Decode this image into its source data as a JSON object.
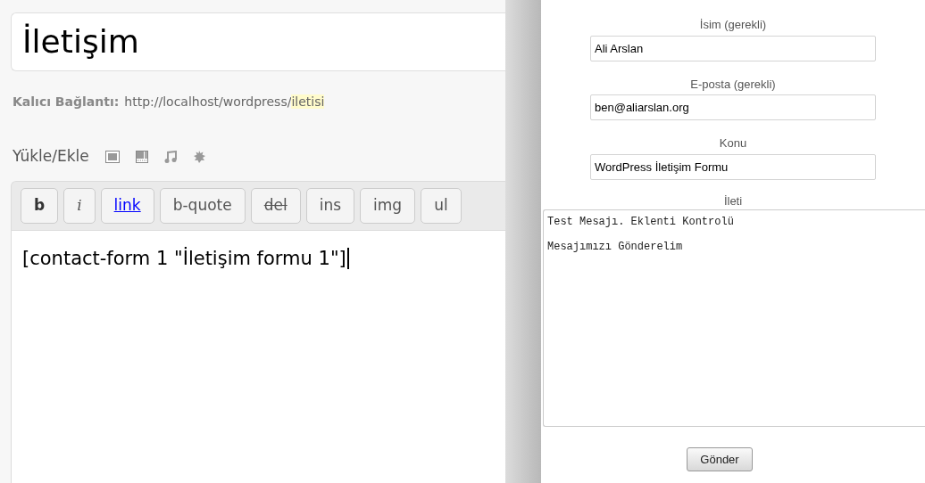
{
  "editor": {
    "title": "İletişim",
    "permalink": {
      "label": "Kalıcı Bağlantı:",
      "base": "http://localhost/wordpress/",
      "slug": "iletisi"
    },
    "upload_label": "Yükle/Ekle",
    "media_icons": [
      {
        "kind": "image"
      },
      {
        "kind": "video"
      },
      {
        "kind": "audio"
      },
      {
        "kind": "media"
      }
    ],
    "toolbar": [
      {
        "label": "b",
        "kind": "bold"
      },
      {
        "label": "i",
        "kind": "italic"
      },
      {
        "label": "link",
        "kind": "link"
      },
      {
        "label": "b-quote",
        "kind": "plain"
      },
      {
        "label": "del",
        "kind": "strike"
      },
      {
        "label": "ins",
        "kind": "plain"
      },
      {
        "label": "img",
        "kind": "plain"
      },
      {
        "label": "ul",
        "kind": "plain"
      }
    ],
    "content": "[contact-form 1 \"İletişim formu 1\"]"
  },
  "form": {
    "fields": [
      {
        "label": "İsim (gerekli)",
        "value": "Ali Arslan"
      },
      {
        "label": "E-posta (gerekli)",
        "value": "ben@aliarslan.org"
      },
      {
        "label": "Konu",
        "value": "WordPress İletişim Formu"
      }
    ],
    "message": {
      "label": "İleti",
      "paragraphs": [
        "Test Mesajı. Eklenti Kontrolü",
        "Mesajımızı Gönderelim"
      ]
    },
    "submit": "Gönder"
  }
}
